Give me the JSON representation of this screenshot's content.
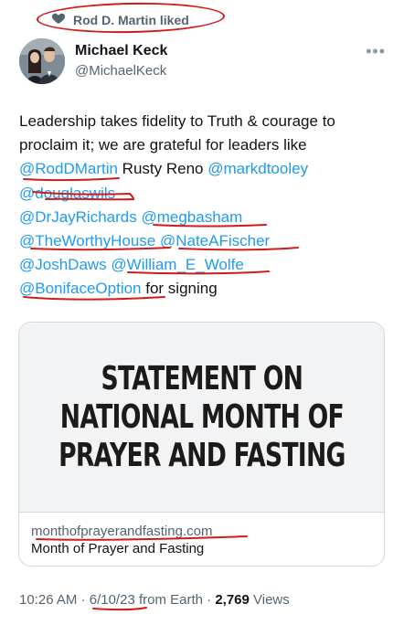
{
  "liked_by": {
    "text": "Rod D. Martin liked",
    "icon": "heart-icon"
  },
  "author": {
    "name": "Michael Keck",
    "handle": "@MichaelKeck"
  },
  "tweet": {
    "line1": "Leadership takes fidelity to Truth & courage to",
    "line2": "proclaim it; we are grateful for leaders like",
    "line3": {
      "mention1": "@RodDMartin",
      "plain": " Rusty Reno ",
      "mention2": "@markdtooley"
    },
    "line4": {
      "mention": "@douglaswils"
    },
    "line5": {
      "mention1": "@DrJayRichards",
      "mention2": "@megbasham"
    },
    "line6": {
      "mention1": "@TheWorthyHouse",
      "mention2": "@NateAFischer"
    },
    "line7": {
      "mention1": "@JoshDaws",
      "mention2": "@William_E_Wolfe"
    },
    "line8": {
      "mention": "@BonifaceOption",
      "plain": " for signing"
    }
  },
  "card": {
    "title_line1": "STATEMENT ON",
    "title_line2": "NATIONAL MONTH OF",
    "title_line3": "PRAYER AND FASTING",
    "domain": "monthofprayerandfasting.com",
    "name": "Month of Prayer and Fasting"
  },
  "meta": {
    "time": "10:26 AM",
    "sep1": " · ",
    "date": "6/10/23",
    "source": " from Earth",
    "sep2": " · ",
    "views_count": "2,769",
    "views_label": " Views"
  },
  "colors": {
    "mention": "#1d9bf0",
    "secondary": "#536471",
    "annotation_red": "#d11a1a"
  }
}
